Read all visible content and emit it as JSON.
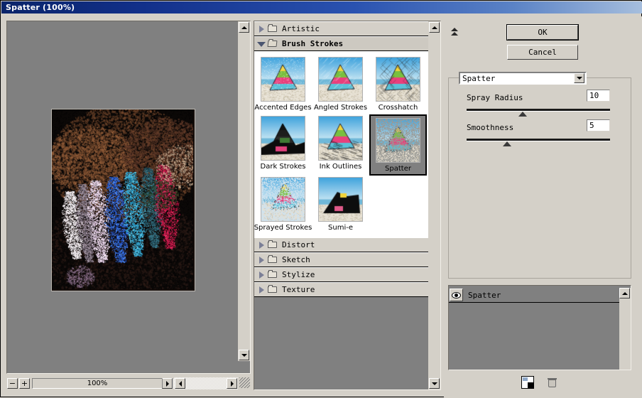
{
  "window": {
    "title": "Spatter (100%)"
  },
  "preview": {
    "zoom_minus_label": "−",
    "zoom_plus_label": "+",
    "zoom_value": "100%",
    "zoom_menu_icon": "triangle-right-icon",
    "scroll_up_icon": "scroll-up-icon",
    "scroll_down_icon": "scroll-down-icon",
    "scroll_left_icon": "scroll-left-icon",
    "scroll_right_icon": "scroll-right-icon",
    "resize_grip_icon": "resize-grip-icon"
  },
  "gallery": {
    "categories": [
      {
        "label": "Artistic",
        "expanded": false,
        "arrow_icon": "triangle-right-icon"
      },
      {
        "label": "Brush Strokes",
        "expanded": true,
        "arrow_icon": "triangle-down-icon"
      },
      {
        "label": "Distort",
        "expanded": false,
        "arrow_icon": "triangle-right-icon"
      },
      {
        "label": "Sketch",
        "expanded": false,
        "arrow_icon": "triangle-right-icon"
      },
      {
        "label": "Stylize",
        "expanded": false,
        "arrow_icon": "triangle-right-icon"
      },
      {
        "label": "Texture",
        "expanded": false,
        "arrow_icon": "triangle-right-icon"
      }
    ],
    "filters": [
      {
        "label": "Accented Edges",
        "selected": false
      },
      {
        "label": "Angled Strokes",
        "selected": false
      },
      {
        "label": "Crosshatch",
        "selected": false
      },
      {
        "label": "Dark Strokes",
        "selected": false
      },
      {
        "label": "Ink Outlines",
        "selected": false
      },
      {
        "label": "Spatter",
        "selected": true
      },
      {
        "label": "Sprayed Strokes",
        "selected": false
      },
      {
        "label": "Sumi-e",
        "selected": false
      }
    ],
    "scroll_up_icon": "scroll-up-icon",
    "scroll_down_icon": "scroll-down-icon"
  },
  "right_panel": {
    "collapse_icon": "double-chevron-up-icon",
    "ok_label": "OK",
    "cancel_label": "Cancel",
    "filter_select_value": "Spatter",
    "filter_select_arrow_icon": "chevron-down-icon",
    "controls": [
      {
        "label": "Spray Radius",
        "value": "10",
        "thumb_pct": 39
      },
      {
        "label": "Smoothness",
        "value": "5",
        "thumb_pct": 28
      }
    ],
    "layers": [
      {
        "name": "Spatter",
        "visible": true,
        "visibility_icon": "eye-icon"
      }
    ],
    "new_layer_icon": "new-effect-layer-icon",
    "delete_layer_icon": "trash-icon",
    "layer_scroll_up_icon": "scroll-up-icon"
  },
  "colors": {
    "titlebar_start": "#0a246a",
    "titlebar_end": "#a6bedd",
    "face": "#d4d0c8",
    "canvas_gray": "#808080",
    "selection_gray": "#808080"
  }
}
